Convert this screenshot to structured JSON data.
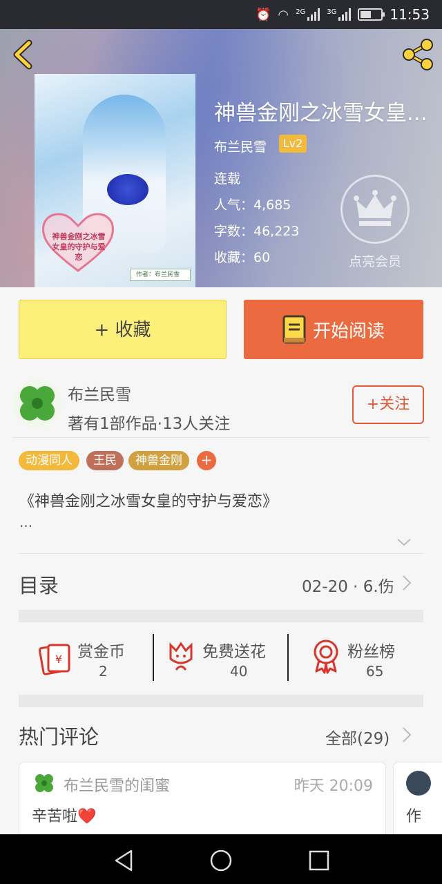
{
  "status_bar": {
    "time": "11:53",
    "net1": "2G",
    "net2": "3G"
  },
  "book": {
    "title": "神兽金刚之冰雪女皇...",
    "author": "布兰民雪",
    "level": "Lv2",
    "status": "连载",
    "popularity": "人气：4,685",
    "word_count": "字数：46,223",
    "favorites": "收藏：60",
    "vip_label": "点亮会员"
  },
  "cover": {
    "heart_text": "神兽金刚之冰雪女皇的守护与爱恋",
    "author_tag": "作者：布兰民雪"
  },
  "actions": {
    "collect": "+ 收藏",
    "read": "开始阅读"
  },
  "author_row": {
    "name": "布兰民雪",
    "subtitle": "著有1部作品·13人关注",
    "follow": "+关注"
  },
  "tags": [
    {
      "label": "动漫同人",
      "color": "#f2b93a"
    },
    {
      "label": "王民",
      "color": "#c0705a"
    },
    {
      "label": "神兽金刚",
      "color": "#d1a040"
    }
  ],
  "tag_add": "+",
  "description": {
    "text": "《神兽金刚之冰雪女皇的守护与爱恋》",
    "more": "..."
  },
  "catalog": {
    "title": "目录",
    "latest": "02-20 · 6.伤"
  },
  "stats": [
    {
      "label": "赏金币",
      "value": "2",
      "icon": "red-envelope-icon"
    },
    {
      "label": "免费送花",
      "value": "40",
      "icon": "flower-icon"
    },
    {
      "label": "粉丝榜",
      "value": "65",
      "icon": "medal-icon"
    }
  ],
  "comments": {
    "title": "热门评论",
    "all": "全部(29)",
    "items": [
      {
        "user": "布兰民雪的闺蜜",
        "time": "昨天 20:09",
        "text": "辛苦啦❤️"
      }
    ],
    "peek_text": "作"
  },
  "colors": {
    "accent": "#ec6a3f",
    "collect": "#fcf07a",
    "back": "#ffd23e"
  }
}
